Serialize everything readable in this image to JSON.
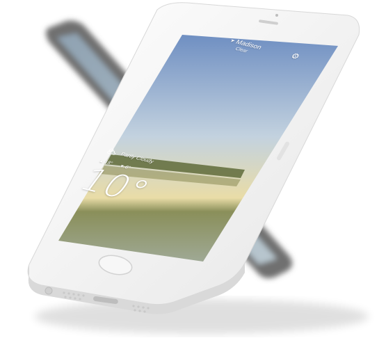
{
  "location": {
    "city": "Madison",
    "subtitle": "Clear",
    "arrow_icon": "location-arrow-icon"
  },
  "settings": {
    "icon": "gear-icon",
    "glyph": "⚙"
  },
  "weather": {
    "condition": "Partly Cloudy",
    "condition_icon": "partly-cloudy-icon",
    "high": "18°",
    "low": "6°",
    "temperature": "10°"
  },
  "colors": {
    "sky_top": "#6f8fc2",
    "sky_mid": "#c9d6dd",
    "horizon": "#e8d7a4",
    "water": "#9aa68e",
    "phone_body": "#f2f2f2"
  }
}
